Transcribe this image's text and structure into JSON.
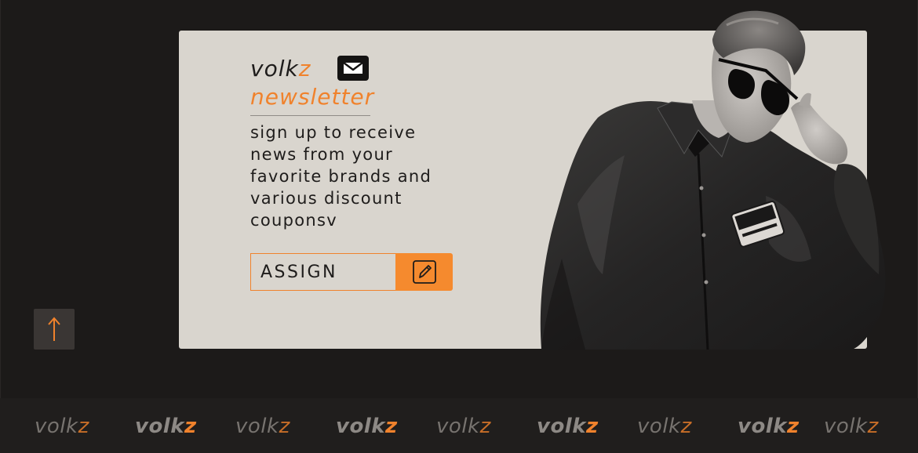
{
  "brand": {
    "name": "volk",
    "accent_letter": "z"
  },
  "newsletter": {
    "title": "newsletter",
    "description": "sign up to receive\nnews from your\nfavorite brands and\nvarious discount\ncouponsv",
    "field_label": "ASSIGN",
    "icons": {
      "badge": "mail-icon",
      "submit": "edit-pencil-icon",
      "scroll": "arrow-up-icon"
    }
  },
  "colors": {
    "accent": "#f0822c",
    "card": "#d9d5ce",
    "background": "#1c1a19",
    "dark": "#141312"
  },
  "footer": {
    "ticker": [
      {
        "base": "volk",
        "accent": "z",
        "style": "light"
      },
      {
        "base": "volk",
        "accent": "z",
        "style": "bold"
      },
      {
        "base": "volk",
        "accent": "z",
        "style": "light"
      },
      {
        "base": "volk",
        "accent": "z",
        "style": "bold"
      },
      {
        "base": "volk",
        "accent": "z",
        "style": "light"
      },
      {
        "base": "volk",
        "accent": "z",
        "style": "bold"
      },
      {
        "base": "volk",
        "accent": "z",
        "style": "light"
      },
      {
        "base": "volk",
        "accent": "z",
        "style": "bold"
      },
      {
        "base": "volk",
        "accent": "z",
        "style": "light"
      }
    ]
  }
}
